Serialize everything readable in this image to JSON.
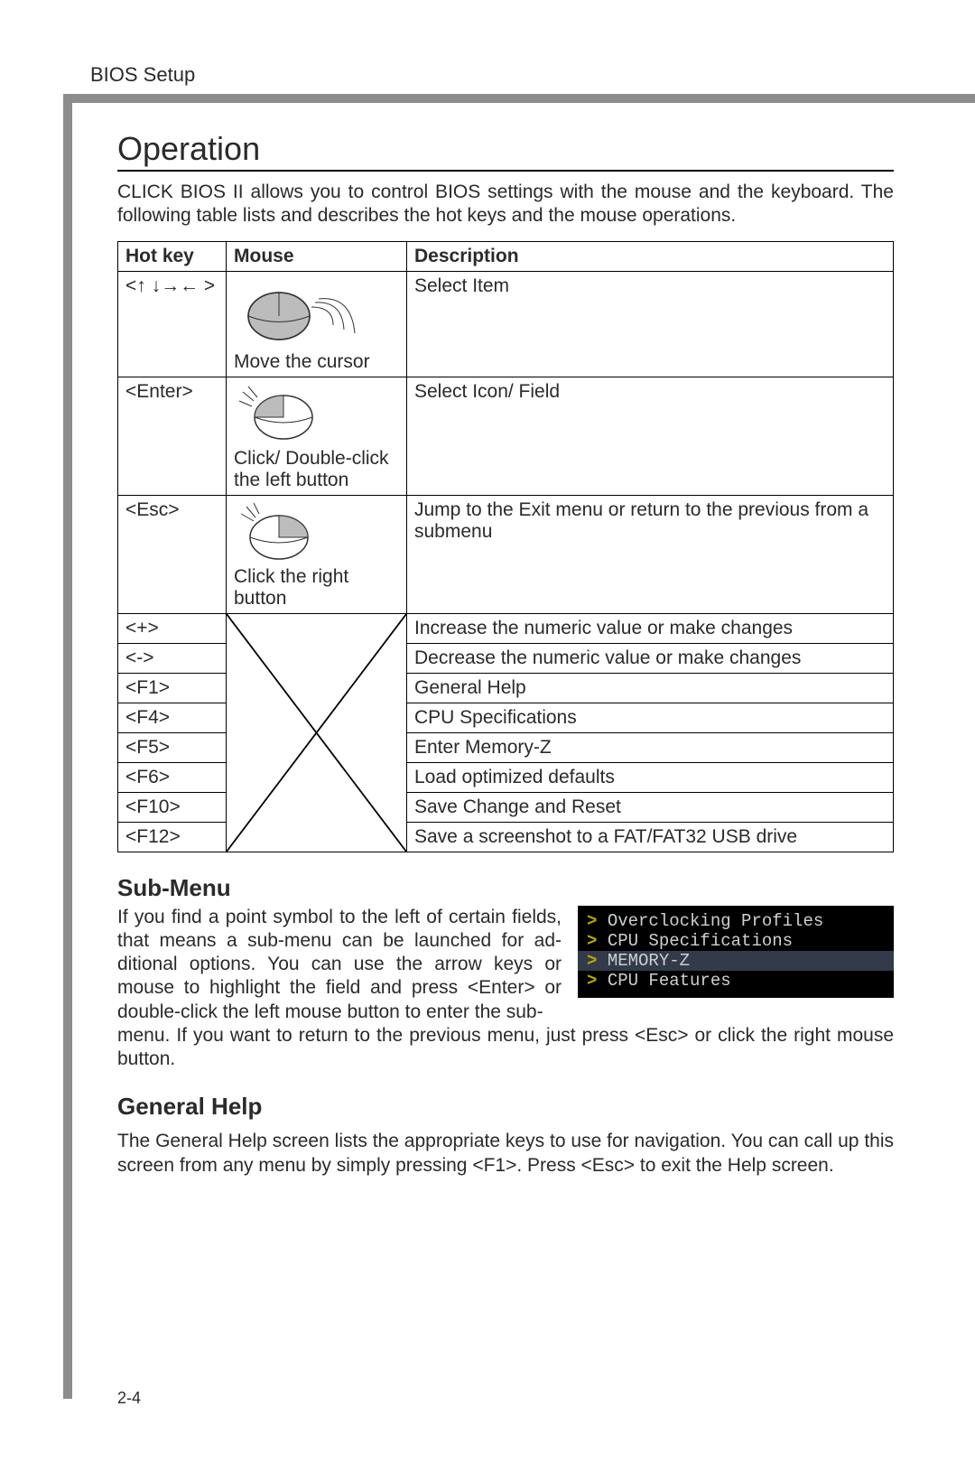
{
  "chapter": "BIOS Setup",
  "title": "Operation",
  "intro": "CLICK BIOS II allows you to control BIOS settings with the mouse and the keyboard. The following table lists and describes the hot keys and the mouse operations.",
  "table": {
    "headers": {
      "hotkey": "Hot key",
      "mouse": "Mouse",
      "desc": "Description"
    },
    "rows_grouped": [
      {
        "hotkey": "<↑ ↓→← >",
        "mouse_caption": "Move the cursor",
        "desc": "Select Item"
      },
      {
        "hotkey": "<Enter>",
        "mouse_caption": "Click/ Double-click the left button",
        "desc": "Select  Icon/ Field"
      },
      {
        "hotkey": "<Esc>",
        "mouse_caption": "Click the right button",
        "desc": "Jump to the Exit menu or return to the previous from a submenu"
      }
    ],
    "rows_simple": [
      {
        "hotkey": "<+>",
        "desc": "Increase the numeric value or make changes"
      },
      {
        "hotkey": "<->",
        "desc": "Decrease the numeric value or make changes"
      },
      {
        "hotkey": "<F1>",
        "desc": "General Help"
      },
      {
        "hotkey": "<F4>",
        "desc": "CPU Specifications"
      },
      {
        "hotkey": "<F5>",
        "desc": "Enter Memory-Z"
      },
      {
        "hotkey": "<F6>",
        "desc": "Load optimized defaults"
      },
      {
        "hotkey": "<F10>",
        "desc": "Save Change and Reset"
      },
      {
        "hotkey": "<F12>",
        "desc": "Save a screenshot to a FAT/FAT32 USB drive"
      }
    ]
  },
  "submenu": {
    "heading": "Sub-Menu",
    "text_left": "If you find a point symbol to the left of certain fields, that means a sub-menu can be launched for ad­ditional options. You can use the arrow keys or mouse to highlight the field and press <Enter> or double-click the left mouse button to enter the sub-",
    "text_full_continue": "menu. If you want to return to the previous menu, just press <Esc> or click the right mouse button.",
    "items": [
      {
        "label": "Overclocking Profiles",
        "selected": false
      },
      {
        "label": "CPU Specifications",
        "selected": false
      },
      {
        "label": "MEMORY-Z",
        "selected": true
      },
      {
        "label": "CPU Features",
        "selected": false
      }
    ]
  },
  "general_help": {
    "heading": "General Help",
    "text": "The General Help screen lists the appropriate keys to use for navigation. You can call up this screen from any menu by simply pressing <F1>. Press <Esc> to exit the Help screen."
  },
  "page_number": "2-4"
}
